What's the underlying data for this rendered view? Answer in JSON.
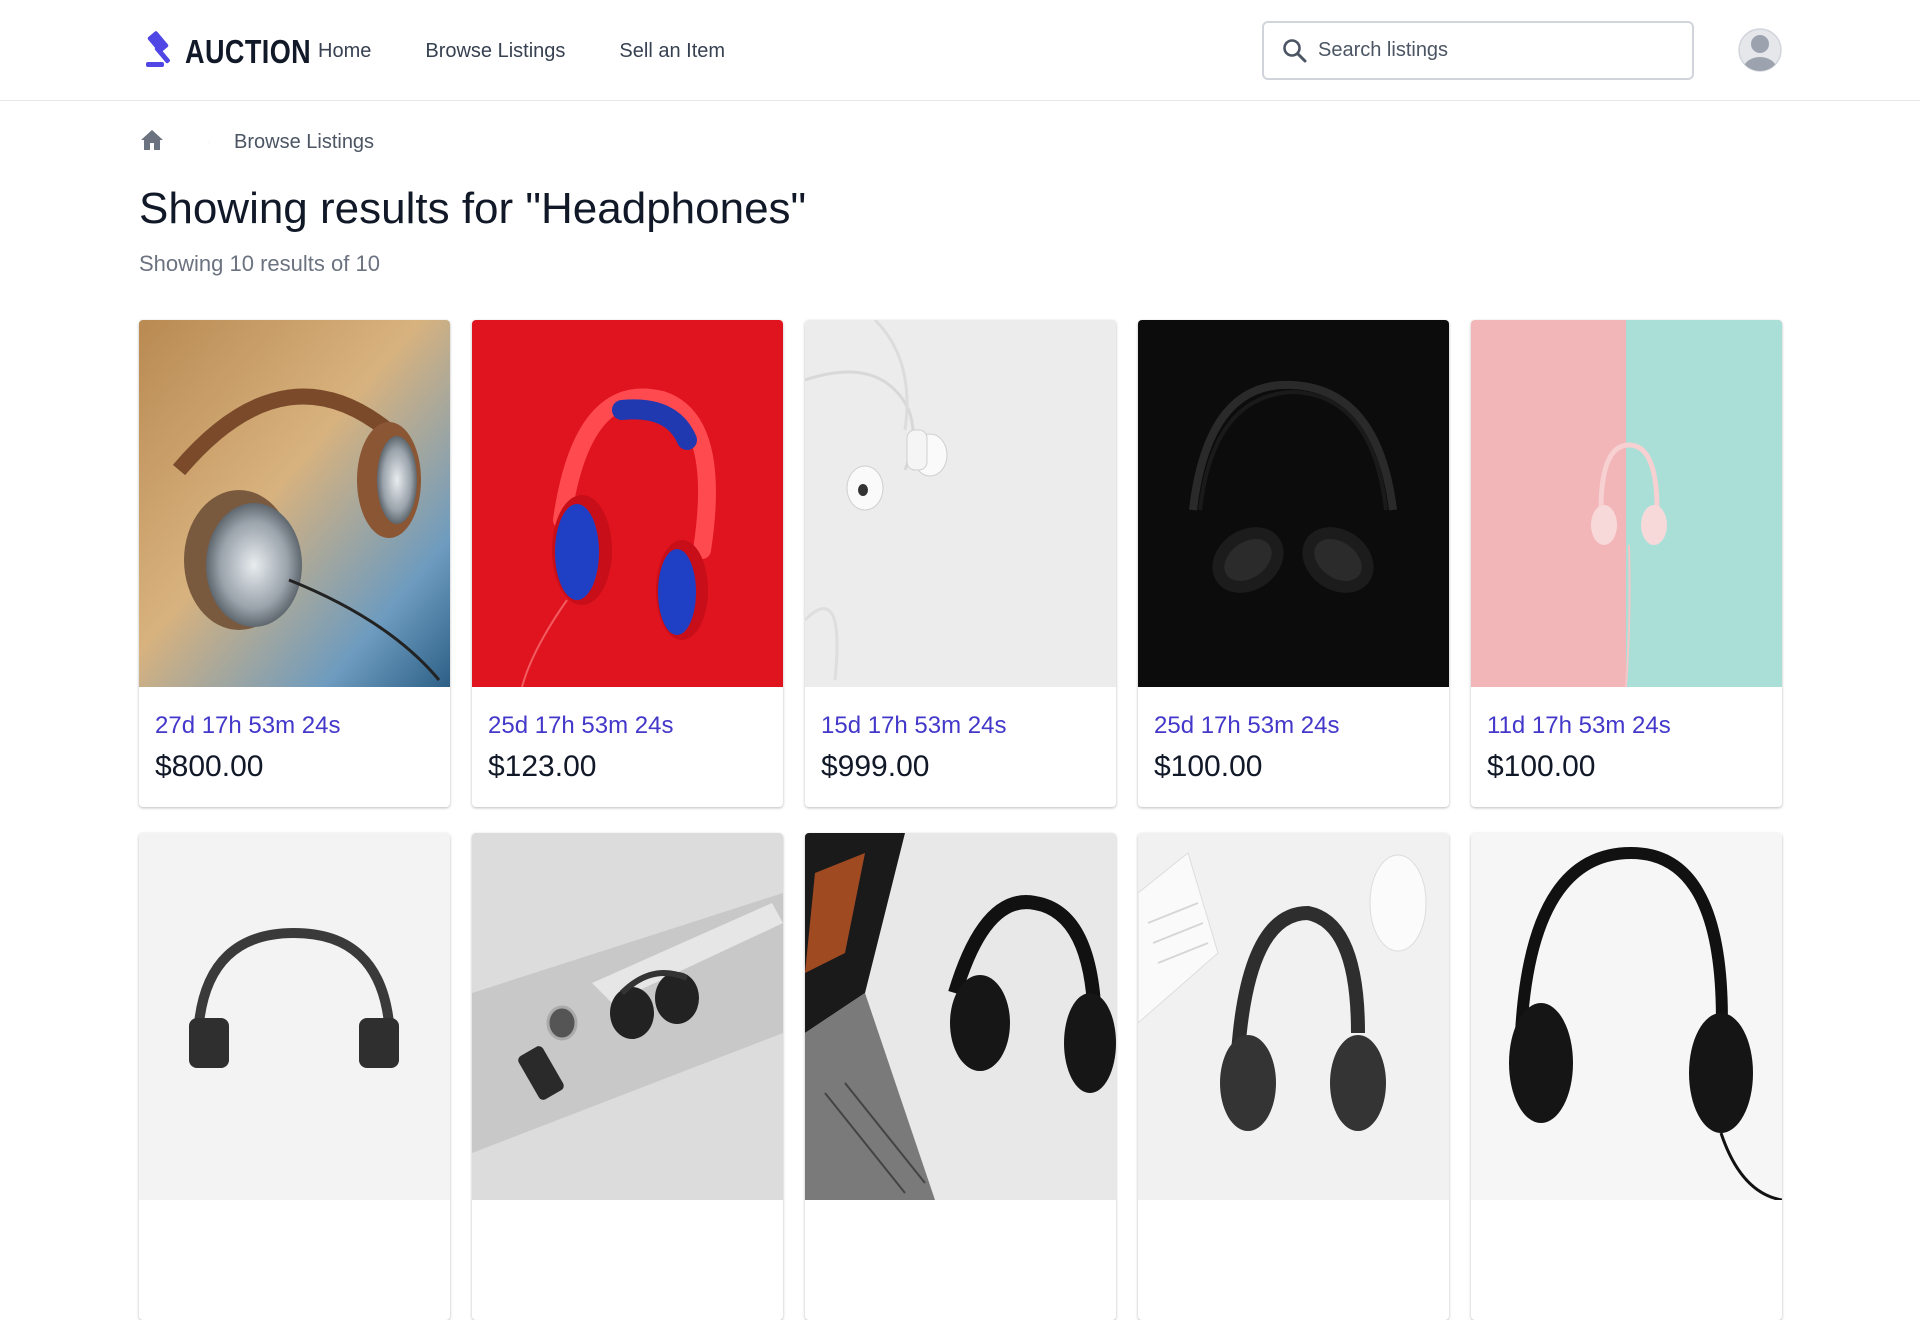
{
  "app": {
    "brand": "AUCTION"
  },
  "nav": [
    {
      "label": "Home"
    },
    {
      "label": "Browse Listings"
    },
    {
      "label": "Sell an Item"
    }
  ],
  "search": {
    "placeholder": "Search listings"
  },
  "breadcrumb": {
    "current": "Browse Listings"
  },
  "results": {
    "title": "Showing results for \"Headphones\"",
    "summary": "Showing 10 results of 10"
  },
  "listings": [
    {
      "time_left": "27d 17h 53m 24s",
      "price": "$800.00"
    },
    {
      "time_left": "25d 17h 53m 24s",
      "price": "$123.00"
    },
    {
      "time_left": "15d 17h 53m 24s",
      "price": "$999.00"
    },
    {
      "time_left": "25d 17h 53m 24s",
      "price": "$100.00"
    },
    {
      "time_left": "11d 17h 53m 24s",
      "price": "$100.00"
    },
    {
      "time_left": "",
      "price": ""
    },
    {
      "time_left": "",
      "price": ""
    },
    {
      "time_left": "",
      "price": ""
    },
    {
      "time_left": "",
      "price": ""
    },
    {
      "time_left": "",
      "price": ""
    }
  ],
  "icons": {
    "logo": "gavel-icon",
    "search": "search-icon",
    "avatar": "user-avatar-icon",
    "breadcrumb_home": "home-icon"
  },
  "colors": {
    "accent": "#4f46e5",
    "time_text": "#4338ca",
    "card_bg_red": "#e0141e",
    "card_bg_black": "#0c0c0c",
    "card_bg_pink": "#f2b6b8",
    "card_bg_mint": "#a9dfd6"
  }
}
